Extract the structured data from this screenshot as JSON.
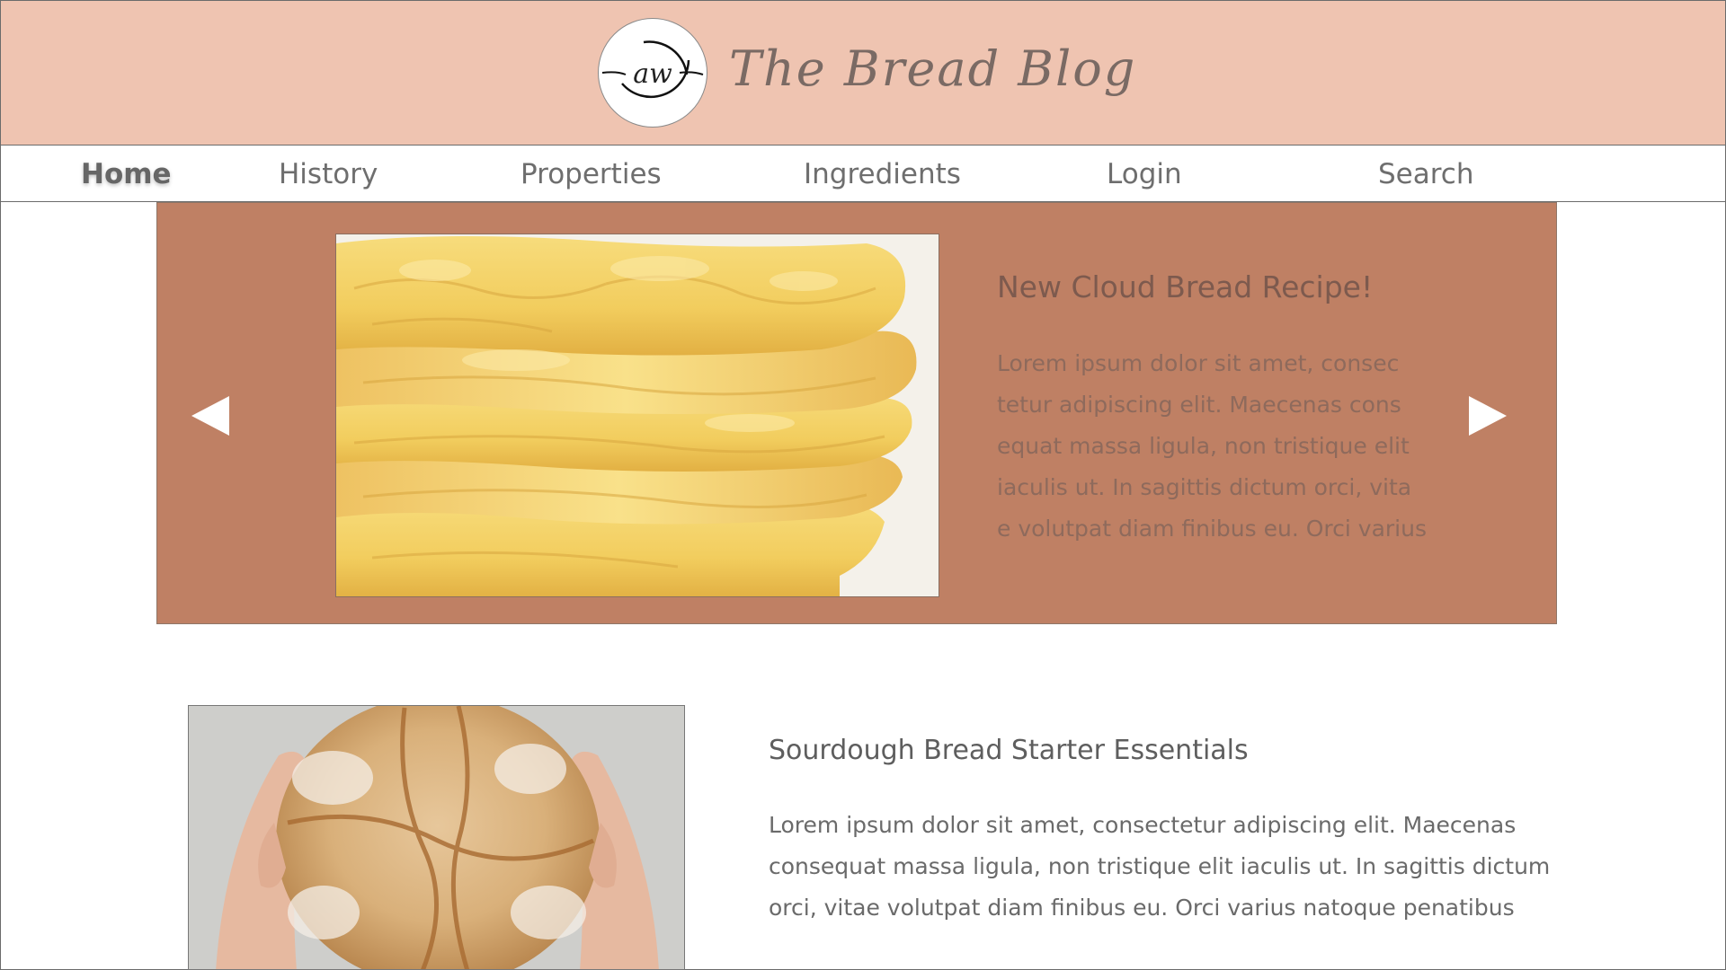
{
  "header": {
    "logo_text": "aw",
    "site_title": "The Bread Blog"
  },
  "nav": {
    "items": [
      {
        "label": "Home",
        "active": true
      },
      {
        "label": "History"
      },
      {
        "label": "Properties"
      },
      {
        "label": "Ingredients"
      },
      {
        "label": "Login"
      },
      {
        "label": "Search"
      }
    ]
  },
  "carousel": {
    "title": "New Cloud Bread Recipe!",
    "text_lines": [
      "Lorem ipsum dolor sit amet, consec",
      "tetur adipiscing elit. Maecenas cons",
      "equat massa ligula, non tristique elit",
      " iaculis ut. In sagittis dictum orci, vita",
      "e volutpat diam finibus eu. Orci varius"
    ],
    "prev_icon": "triangle-left-icon",
    "next_icon": "triangle-right-icon",
    "image": "cloud-bread-stack-photo"
  },
  "article": {
    "title": "Sourdough Bread Starter Essentials",
    "text_lines": [
      "Lorem ipsum dolor sit amet, consectetur adipiscing elit. Maecenas",
      "consequat massa ligula, non tristique elit iaculis ut. In sagittis dictum",
      "orci, vitae volutpat diam finibus eu. Orci varius natoque penatibus"
    ],
    "image": "sourdough-loaf-in-hands-photo"
  },
  "colors": {
    "header_bg": "#efc4b1",
    "carousel_bg": "#bf8064",
    "page_bg": "#ffffff"
  }
}
